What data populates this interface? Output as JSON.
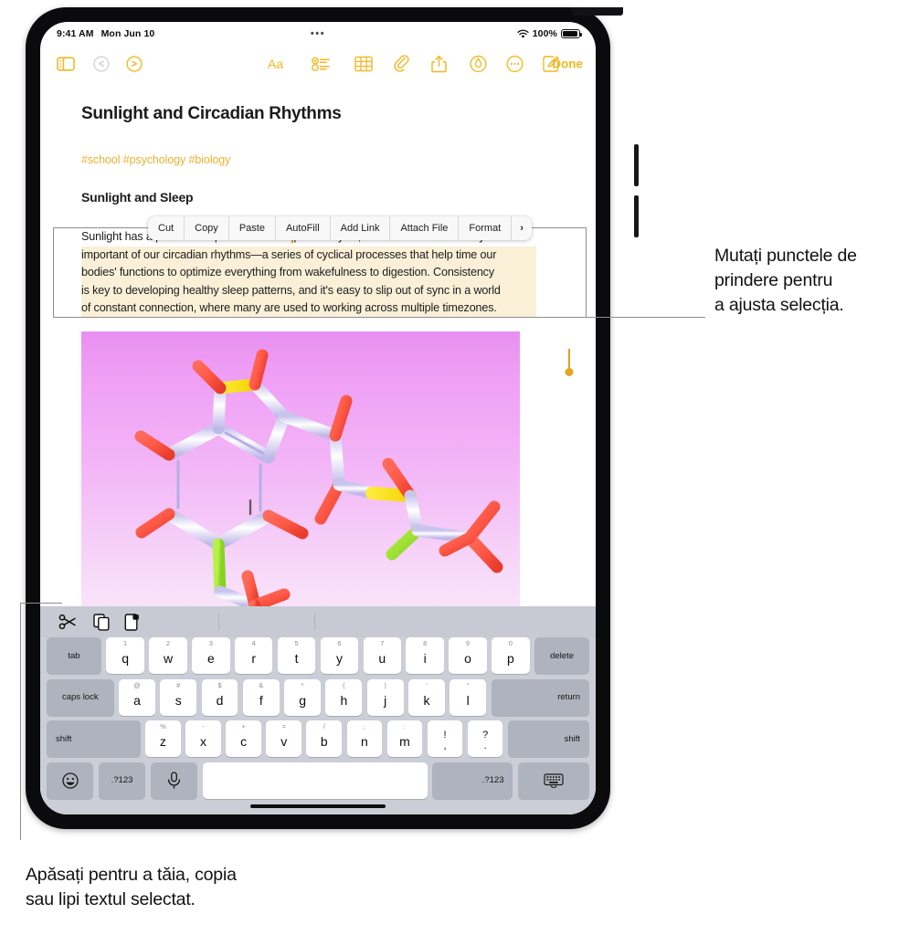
{
  "status_bar": {
    "time": "9:41 AM",
    "date": "Mon Jun 10",
    "center_dots": "•••",
    "battery_percent": "100%",
    "wifi_icon": "wifi-icon",
    "battery_icon": "battery-icon"
  },
  "toolbar": {
    "sidebar_icon": "sidebar-icon",
    "undo_icon": "undo-icon",
    "redo_icon": "redo-icon",
    "format_icon": "format-aa-icon",
    "checklist_icon": "checklist-icon",
    "table_icon": "table-icon",
    "attachment_icon": "paperclip-icon",
    "share_icon": "share-icon",
    "markup_icon": "markup-pen-icon",
    "more_icon": "more-ellipsis-icon",
    "compose_icon": "compose-icon",
    "done_label": "Done"
  },
  "note": {
    "title": "Sunlight and Circadian Rhythms",
    "tags": "#school #psychology #biology",
    "heading": "Sunlight and Sleep",
    "paragraph_lines": [
      "Sunlight has a profound impact on the sleep/wake cycle, one of the most crucially",
      "important of our circadian rhythms—a series of cyclical processes that help time our",
      "bodies' functions to optimize everything from wakefulness to digestion. Consistency",
      "is key to developing healthy sleep patterns, and it's easy to slip out of sync in a world",
      "of constant connection, where many are used to working across multiple timezones."
    ],
    "selection_highlight_color": "#FAF0D7",
    "handle_color": "#E3A51F"
  },
  "edit_menu": {
    "items": [
      {
        "label": "Cut"
      },
      {
        "label": "Copy"
      },
      {
        "label": "Paste"
      },
      {
        "label": "AutoFill"
      },
      {
        "label": "Add Link"
      },
      {
        "label": "Attach File"
      },
      {
        "label": "Format"
      },
      {
        "label": "›"
      }
    ]
  },
  "attachment": {
    "name": "molecule-3d-image",
    "background_top_color": "#e88ff0",
    "background_bottom_color": "#fdf4fd"
  },
  "keyboard": {
    "shortcut_bar": {
      "cut_icon": "scissors-icon",
      "copy_icon": "copy-icon",
      "paste_icon": "paste-icon"
    },
    "row1": [
      {
        "label": "tab",
        "type": "mod"
      },
      {
        "label": "q",
        "alt": "1"
      },
      {
        "label": "w",
        "alt": "2"
      },
      {
        "label": "e",
        "alt": "3"
      },
      {
        "label": "r",
        "alt": "4"
      },
      {
        "label": "t",
        "alt": "5"
      },
      {
        "label": "y",
        "alt": "6"
      },
      {
        "label": "u",
        "alt": "7"
      },
      {
        "label": "i",
        "alt": "8"
      },
      {
        "label": "o",
        "alt": "9"
      },
      {
        "label": "p",
        "alt": "0"
      },
      {
        "label": "delete",
        "type": "mod"
      }
    ],
    "row2": [
      {
        "label": "caps lock",
        "type": "mod"
      },
      {
        "label": "a",
        "alt": "@"
      },
      {
        "label": "s",
        "alt": "#"
      },
      {
        "label": "d",
        "alt": "$"
      },
      {
        "label": "f",
        "alt": "&"
      },
      {
        "label": "g",
        "alt": "*"
      },
      {
        "label": "h",
        "alt": "("
      },
      {
        "label": "j",
        "alt": ")"
      },
      {
        "label": "k",
        "alt": "'"
      },
      {
        "label": "l",
        "alt": "\""
      },
      {
        "label": "return",
        "type": "mod"
      }
    ],
    "row3": [
      {
        "label": "shift",
        "type": "mod"
      },
      {
        "label": "z",
        "alt": "%"
      },
      {
        "label": "x",
        "alt": "-"
      },
      {
        "label": "c",
        "alt": "+"
      },
      {
        "label": "v",
        "alt": "="
      },
      {
        "label": "b",
        "alt": "/"
      },
      {
        "label": "n",
        "alt": ";"
      },
      {
        "label": "m",
        "alt": ":"
      },
      {
        "top": "!",
        "bot": ",",
        "type": "two"
      },
      {
        "top": "?",
        "bot": ".",
        "type": "two"
      },
      {
        "label": "shift",
        "type": "mod"
      }
    ],
    "row4": [
      {
        "label": "emoji-icon",
        "type": "icon"
      },
      {
        "label": ".?123",
        "type": "mod"
      },
      {
        "label": "mic-icon",
        "type": "icon"
      },
      {
        "label": "",
        "type": "space"
      },
      {
        "label": ".?123",
        "type": "mod"
      },
      {
        "label": "hide-keyboard-icon",
        "type": "icon"
      }
    ]
  },
  "callouts": {
    "selection": "Mutați punctele de\nprindere pentru\na ajusta selecția.",
    "selection_line1": "Mutați punctele de",
    "selection_line2": "prindere pentru",
    "selection_line3": "a ajusta selecția.",
    "shortcut": "Apăsați pentru a tăia, copia\nsau lipi textul selectat.",
    "shortcut_line1": "Apăsați pentru a tăia, copia",
    "shortcut_line2": "sau lipi textul selectat."
  }
}
